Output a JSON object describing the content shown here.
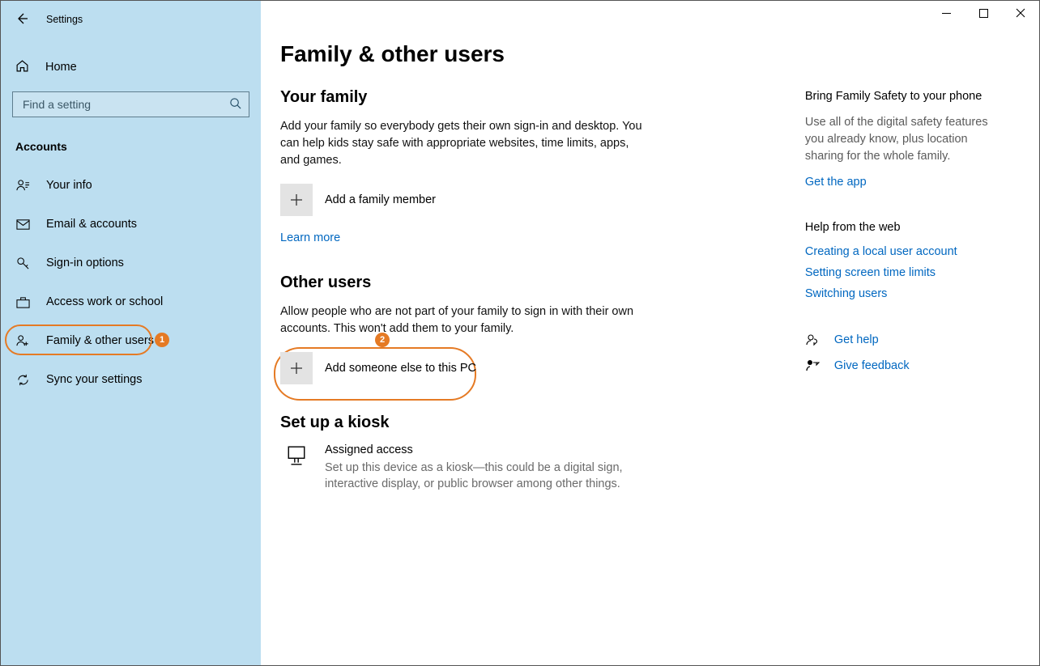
{
  "window": {
    "title": "Settings"
  },
  "sidebar": {
    "home": "Home",
    "search_placeholder": "Find a setting",
    "category": "Accounts",
    "items": [
      {
        "label": "Your info"
      },
      {
        "label": "Email & accounts"
      },
      {
        "label": "Sign-in options"
      },
      {
        "label": "Access work or school"
      },
      {
        "label": "Family & other users"
      },
      {
        "label": "Sync your settings"
      }
    ]
  },
  "page": {
    "title": "Family & other users",
    "family": {
      "heading": "Your family",
      "desc": "Add your family so everybody gets their own sign-in and desktop. You can help kids stay safe with appropriate websites, time limits, apps, and games.",
      "add_label": "Add a family member",
      "learn_more": "Learn more"
    },
    "others": {
      "heading": "Other users",
      "desc": "Allow people who are not part of your family to sign in with their own accounts. This won't add them to your family.",
      "add_label": "Add someone else to this PC"
    },
    "kiosk": {
      "heading": "Set up a kiosk",
      "title": "Assigned access",
      "desc": "Set up this device as a kiosk—this could be a digital sign, interactive display, or public browser among other things."
    }
  },
  "right": {
    "safety": {
      "title": "Bring Family Safety to your phone",
      "desc": "Use all of the digital safety features you already know, plus location sharing for the whole family.",
      "link": "Get the app"
    },
    "web": {
      "title": "Help from the web",
      "links": [
        "Creating a local user account",
        "Setting screen time limits",
        "Switching users"
      ]
    },
    "help": "Get help",
    "feedback": "Give feedback"
  },
  "annotations": {
    "one": "1",
    "two": "2"
  }
}
